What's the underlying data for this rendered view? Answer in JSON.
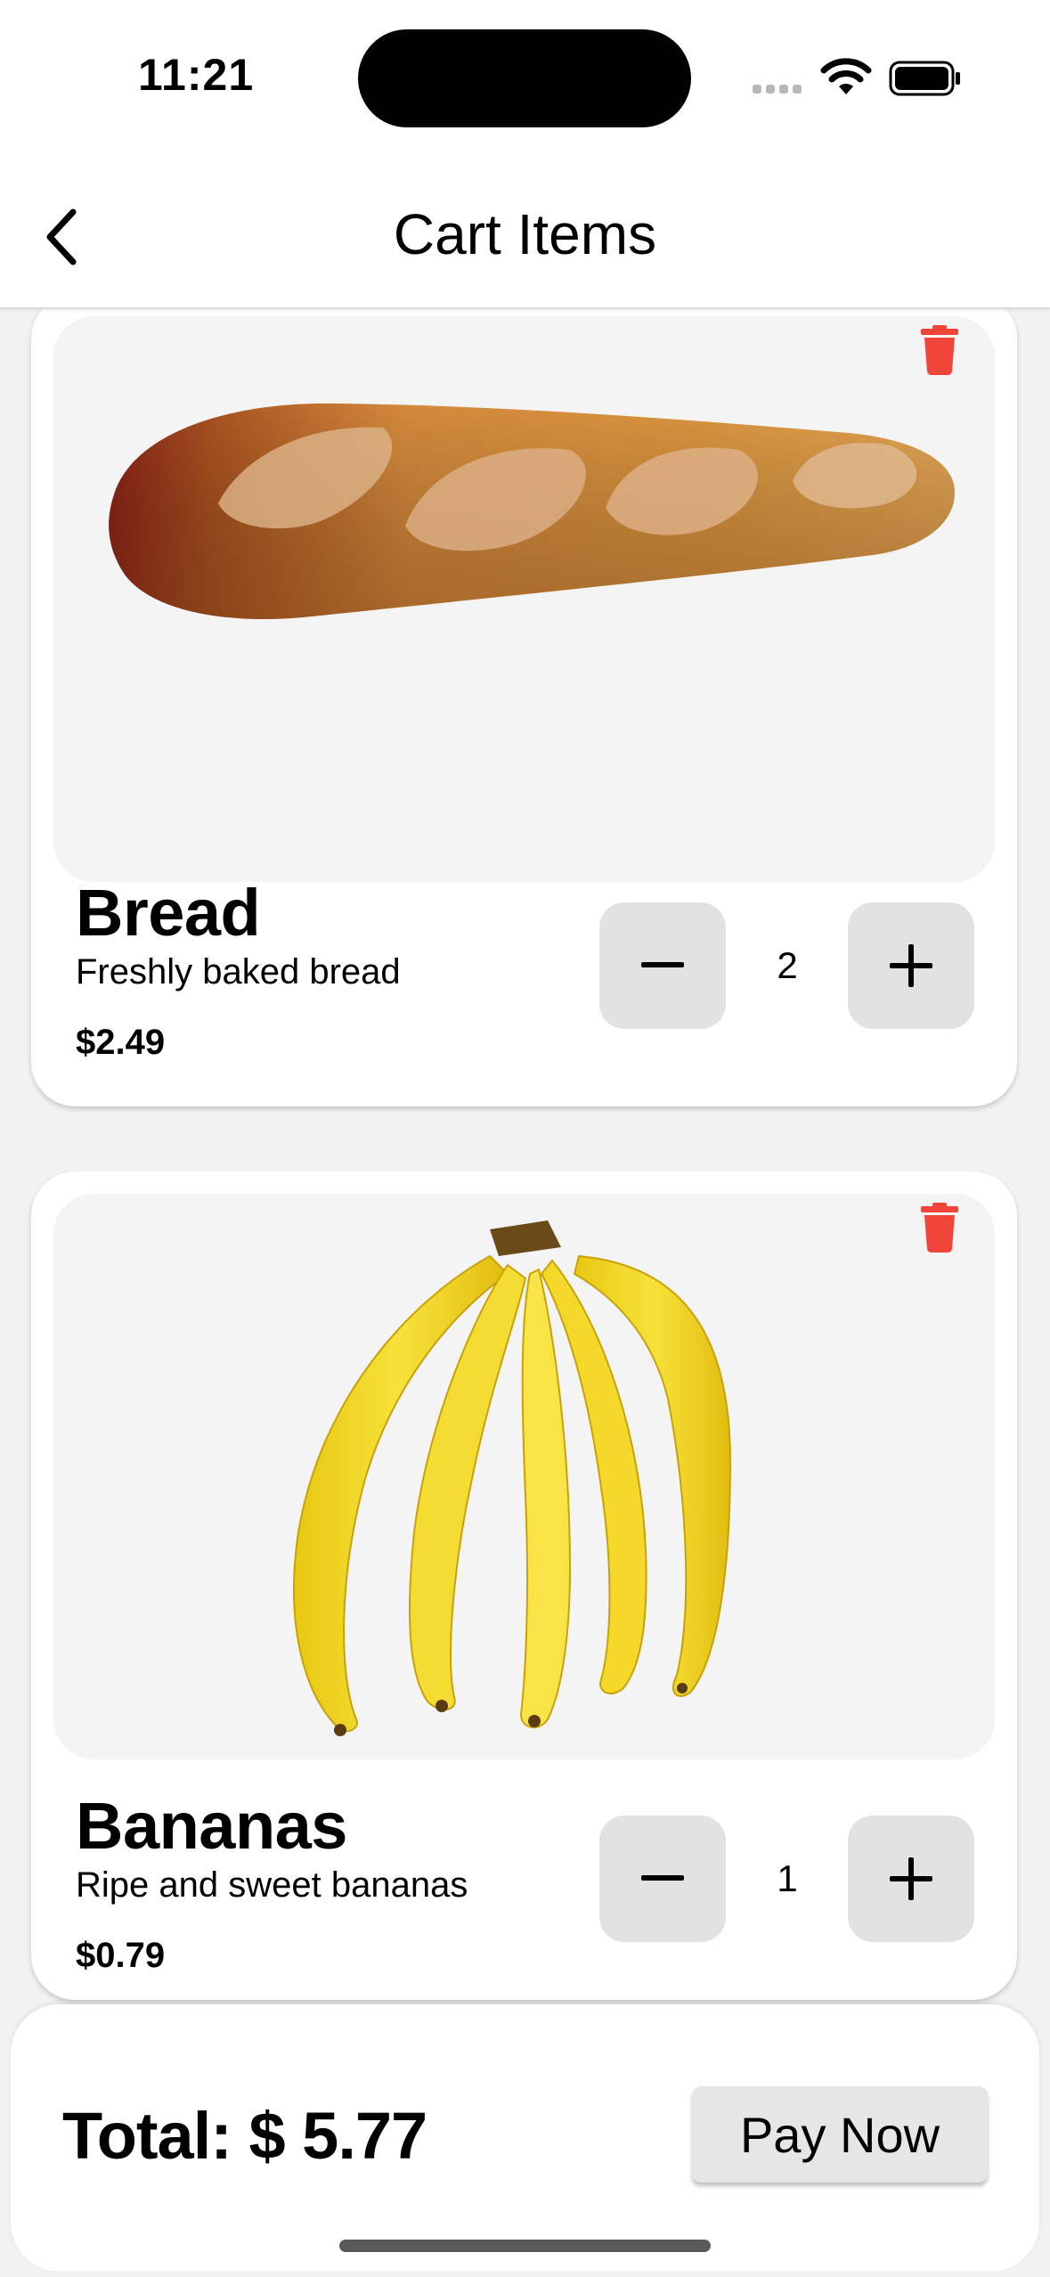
{
  "status_bar": {
    "time": "11:21"
  },
  "nav": {
    "title": "Cart Items"
  },
  "items": [
    {
      "name": "Bread",
      "description": "Freshly baked bread",
      "price": "$2.49",
      "quantity": "2",
      "image": "baguette-image"
    },
    {
      "name": "Bananas",
      "description": "Ripe and sweet bananas",
      "price": "$0.79",
      "quantity": "1",
      "image": "banana-bunch-image"
    }
  ],
  "footer": {
    "total": "Total: $ 5.77",
    "pay_label": "Pay Now"
  },
  "colors": {
    "delete": "#f2453a",
    "qty_button": "#e2e2e2",
    "image_bg": "#f4f4f4",
    "page_bg": "#f2f2f2"
  }
}
